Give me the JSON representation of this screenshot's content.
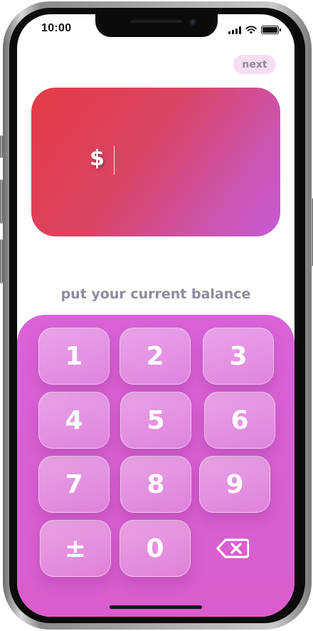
{
  "status_bar": {
    "time": "10:00",
    "icons": [
      "cellular-signal-icon",
      "wifi-icon",
      "battery-icon"
    ]
  },
  "header": {
    "next_label": "next"
  },
  "balance_card": {
    "currency_symbol": "$",
    "amount_value": "",
    "gradient_start": "#e53a45",
    "gradient_end": "#c65ad6"
  },
  "prompt": {
    "text": "put your current balance"
  },
  "keypad": {
    "background": "#d962d9",
    "keys": [
      "1",
      "2",
      "3",
      "4",
      "5",
      "6",
      "7",
      "8",
      "9",
      "±",
      "0"
    ],
    "backspace_icon": "backspace-icon"
  }
}
